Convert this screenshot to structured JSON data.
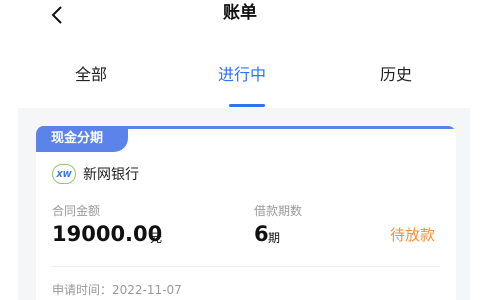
{
  "header": {
    "title": "账单",
    "back_icon": "chevron-left-icon"
  },
  "tabs": [
    {
      "label": "全部",
      "active": false
    },
    {
      "label": "进行中",
      "active": true
    },
    {
      "label": "历史",
      "active": false
    }
  ],
  "colors": {
    "accent": "#2f73f0",
    "badge": "#5b83ea",
    "status": "#f0913c"
  },
  "bill": {
    "type_badge": "现金分期",
    "bank_logo_text": "XW",
    "bank_name": "新网银行",
    "amount_label": "合同金额",
    "amount": "19000.00",
    "amount_unit": "元",
    "term_label": "借款期数",
    "term": "6",
    "term_unit": "期",
    "status": "待放款",
    "apply_time": "申请时间：2022-11-07"
  }
}
